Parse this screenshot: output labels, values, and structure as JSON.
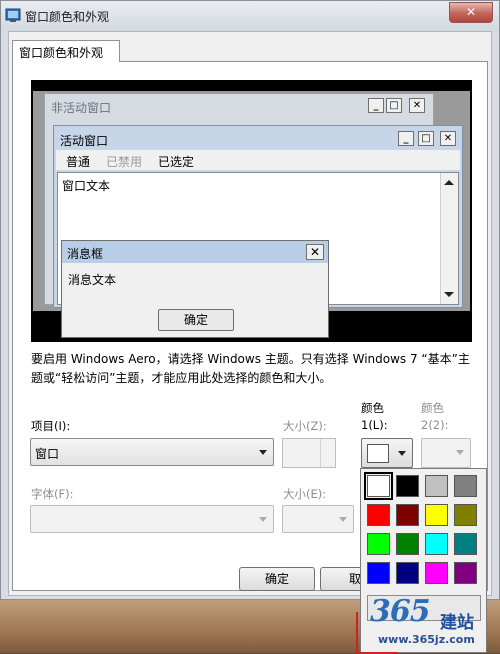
{
  "window": {
    "title": "窗口颜色和外观",
    "close_symbol": "✕"
  },
  "tab": {
    "label": "窗口颜色和外观"
  },
  "preview": {
    "inactive_title": "非活动窗口",
    "active_title": "活动窗口",
    "menu": {
      "normal": "普通",
      "disabled": "已禁用",
      "selected": "已选定"
    },
    "window_text": "窗口文本",
    "msgbox_title": "消息框",
    "msgbox_text": "消息文本",
    "msgbox_ok": "确定",
    "btn_min": "_",
    "btn_max": "□",
    "btn_close": "✕"
  },
  "note": "要启用 Windows Aero，请选择 Windows 主题。只有选择 Windows 7 “基本”主题或“轻松访问”主题，才能应用此处选择的颜色和大小。",
  "fields": {
    "item_label": "项目(I):",
    "item_value": "窗口",
    "size1_label": "大小(Z):",
    "color1_label_line1": "颜色",
    "color1_label_line2": "1(L):",
    "color2_label_line1": "颜色",
    "color2_label_line2": "2(2):",
    "font_label": "字体(F):",
    "size2_label": "大小(E):"
  },
  "palette": {
    "selected_color": "#ffffff",
    "colors": [
      "#ffffff",
      "#000000",
      "#c0c0c0",
      "#808080",
      "#ff0000",
      "#800000",
      "#ffff00",
      "#808000",
      "#00ff00",
      "#008000",
      "#00ffff",
      "#008080",
      "#0000ff",
      "#000080",
      "#ff00ff",
      "#800080"
    ]
  },
  "buttons": {
    "ok": "确定",
    "cancel": "取"
  },
  "watermark": {
    "number": "365",
    "cn": "建站",
    "url": "www.365jz.com"
  }
}
